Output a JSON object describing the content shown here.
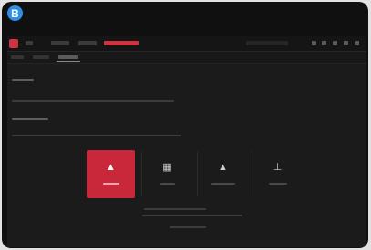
{
  "badge": {
    "label": "B"
  },
  "colors": {
    "accent": "#c8283a",
    "badge": "#2f8fe6",
    "background": "#1b1b1b"
  },
  "tiles": [
    {
      "icon": "person-icon",
      "active": true
    },
    {
      "icon": "columns-icon",
      "active": false
    },
    {
      "icon": "device-icon",
      "active": false
    },
    {
      "icon": "upload-icon",
      "active": false
    }
  ]
}
